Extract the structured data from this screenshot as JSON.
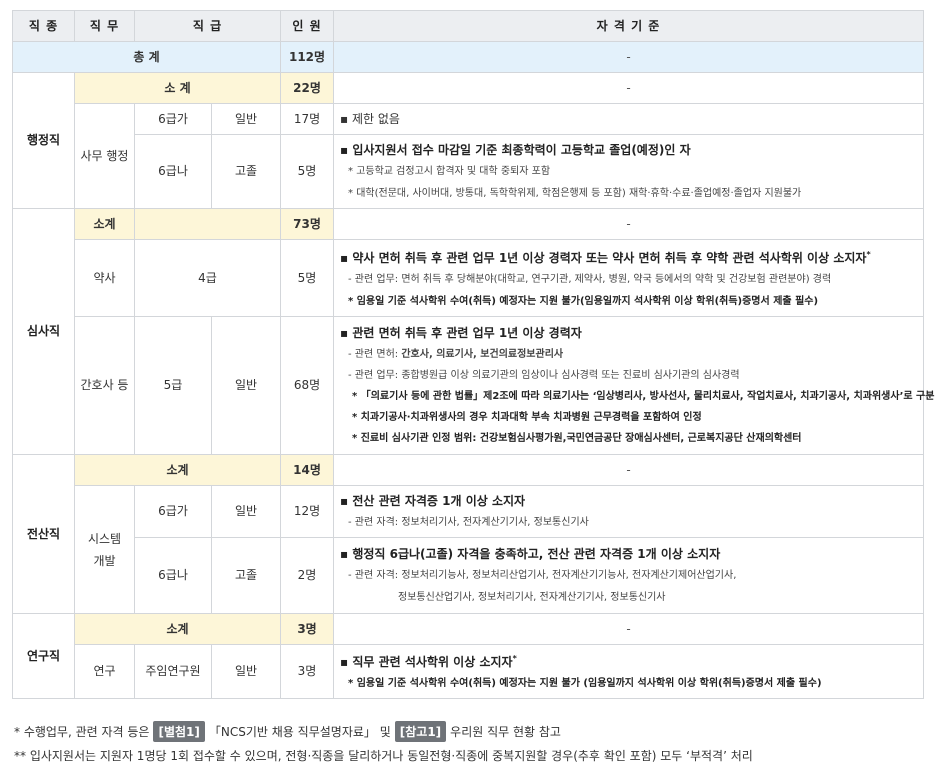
{
  "header": {
    "job_type": "직 종",
    "duty": "직 무",
    "grade": "직 급",
    "count": "인 원",
    "criteria": "자 격 기 준"
  },
  "total": {
    "label": "총 계",
    "count": "112명",
    "criteria": "-"
  },
  "admin": {
    "category": "행정직",
    "subtotal": {
      "label": "소 계",
      "count": "22명",
      "criteria": "-"
    },
    "duty": "사무 행정",
    "rows": [
      {
        "grade": "6급가",
        "type": "일반",
        "count": "17명",
        "criteria": "▪ 제한 없음"
      },
      {
        "grade": "6급나",
        "type": "고졸",
        "count": "5명",
        "main": "▪ 입사지원서 접수 마감일 기준 최종학력이 고등학교 졸업(예정)인 자",
        "note1": "* 고등학교 검정고시 합격자 및 대학 중퇴자 포함",
        "note2": "* 대학(전문대, 사이버대, 방통대, 독학학위제, 학점은행제 등 포함) 재학·휴학·수료·졸업예정·졸업자 지원불가"
      }
    ]
  },
  "review": {
    "category": "심사직",
    "subtotal": {
      "label": "소계",
      "count": "73명",
      "criteria": "-"
    },
    "pharm": {
      "duty": "약사",
      "grade": "4급",
      "count": "5명",
      "main": "▪ 약사 면허 취득 후 관련 업무 1년 이상 경력자 또는 약사 면허 취득 후 약학 관련 석사학위 이상 소지자",
      "line1": "- 관련 업무: 면허 취득 후 당해분야(대학교, 연구기관, 제약사, 병원, 약국 등에서의 약학 및 건강보험 관련분야) 경력",
      "line2": "* 임용일 기준 석사학위 수여(취득) 예정자는 지원 불가(임용일까지 석사학위 이상 학위(취득)증명서 제출 필수)"
    },
    "nurse": {
      "duty": "간호사 등",
      "grade": "5급",
      "type": "일반",
      "count": "68명",
      "main": "▪ 관련 면허 취득 후 관련 업무 1년 이상 경력자",
      "line1_prefix": "- 관련 면허: ",
      "line1_bold": "간호사, 의료기사, 보건의료정보관리사",
      "line2": "- 관련 업무: 종합병원급 이상 의료기관의 임상이나 심사경력 또는 진료비 심사기관의 심사경력",
      "line3": "* 「의료기사 등에 관한 법률」제2조에 따라 의료기사는 ‘임상병리사, 방사선사, 물리치료사, 작업치료사, 치과기공사, 치과위생사’로 구분",
      "line4": "* 치과기공사·치과위생사의 경우 치과대학 부속 치과병원 근무경력을 포함하여 인정",
      "line5": "* 진료비 심사기관 인정 범위: 건강보험심사평가원,국민연금공단 장애심사센터, 근로복지공단 산재의학센터"
    }
  },
  "it": {
    "category": "전산직",
    "subtotal": {
      "label": "소계",
      "count": "14명",
      "criteria": "-"
    },
    "duty": "시스템 개발",
    "rows": [
      {
        "grade": "6급가",
        "type": "일반",
        "count": "12명",
        "main": "▪ 전산 관련 자격증 1개 이상 소지자",
        "line1": "- 관련 자격: 정보처리기사, 전자계산기기사, 정보통신기사"
      },
      {
        "grade": "6급나",
        "type": "고졸",
        "count": "2명",
        "main": "▪ 행정직 6급나(고졸) 자격을 충족하고, 전산 관련 자격증 1개 이상 소지자",
        "line1": "- 관련 자격: 정보처리기능사, 정보처리산업기사, 전자계산기기능사, 전자계산기제어산업기사,",
        "line2": "정보통신산업기사, 정보처리기사, 전자계산기기사, 정보통신기사"
      }
    ]
  },
  "research": {
    "category": "연구직",
    "subtotal": {
      "label": "소계",
      "count": "3명",
      "criteria": "-"
    },
    "row": {
      "duty": "연구",
      "grade": "주임연구원",
      "type": "일반",
      "count": "3명",
      "main": "▪ 직무 관련 석사학위 이상 소지자",
      "line1": "* 임용일 기준 석사학위 수여(취득) 예정자는 지원 불가 (임용일까지 석사학위 이상 학위(취득)증명서 제출 필수)"
    }
  },
  "notes": {
    "n1_prefix": "* 수행업무, 관련 자격 등은",
    "tag1": "[별첨1]",
    "n1_mid": "「NCS기반 채용 직무설명자료」 및",
    "tag2": "[참고1]",
    "n1_suffix": "우리원 직무 현황 참고",
    "n2": "** 입사지원서는 지원자 1명당 1회 접수할 수 있으며, 전형·직종을 달리하거나 동일전형·직종에 중복지원할 경우(추후 확인 포함) 모두 ‘부적격’ 처리"
  }
}
